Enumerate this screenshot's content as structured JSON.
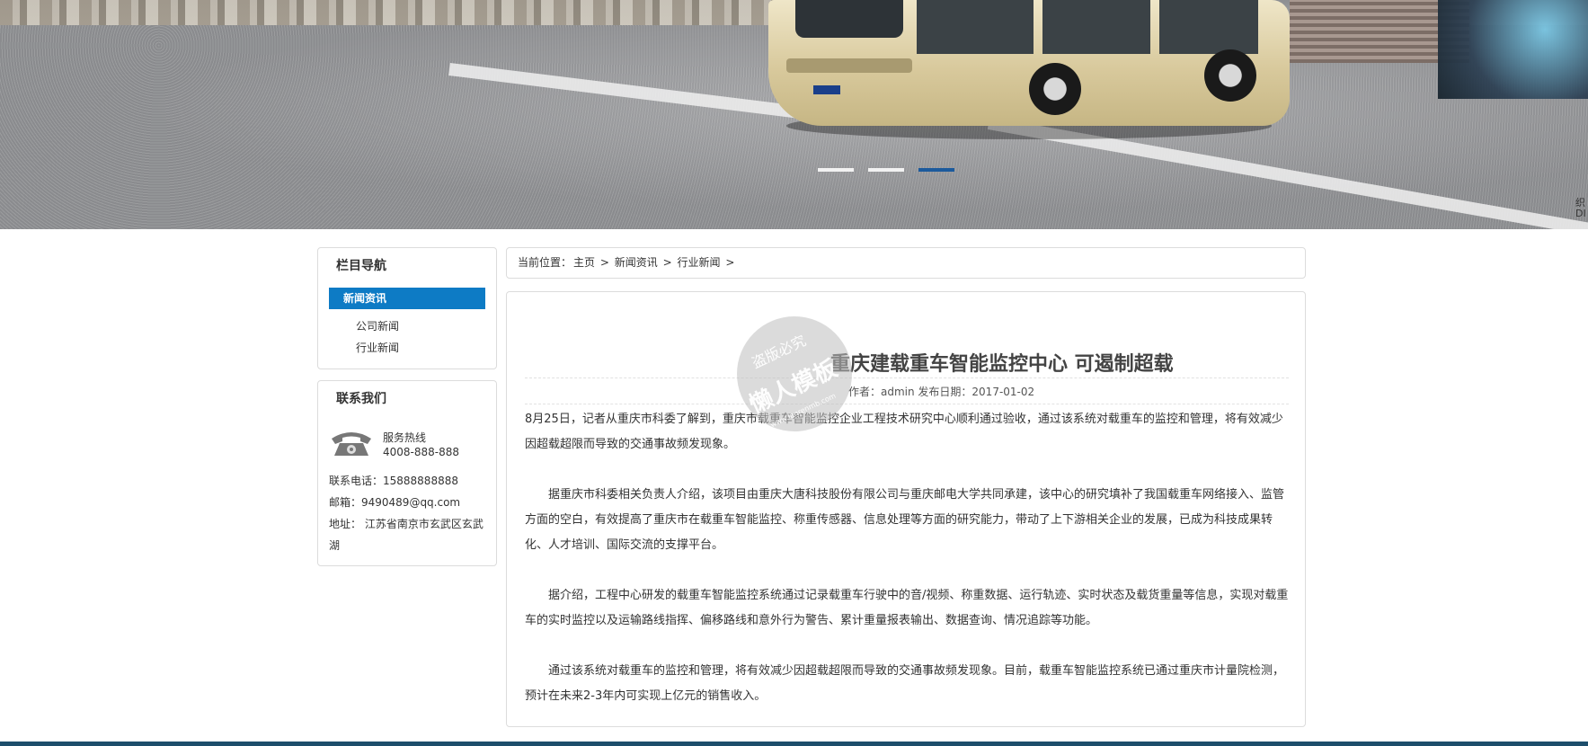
{
  "banner": {
    "slides": 3,
    "active_slide": 3,
    "edge_text": "织DI"
  },
  "sidebar": {
    "nav_title": "栏目导航",
    "active_item": "新闻资讯",
    "sub_items": [
      "公司新闻",
      "行业新闻"
    ],
    "contact_title": "联系我们",
    "hotline_label": "服务热线",
    "hotline_number": "4008-888-888",
    "phone": "联系电话：15888888888",
    "email": "邮箱：9490489@qq.com",
    "address": "地址： 江苏省南京市玄武区玄武湖"
  },
  "breadcrumb": {
    "prefix": "当前位置：",
    "items": [
      "主页",
      "新闻资讯",
      "行业新闻"
    ],
    "separator": ">"
  },
  "article": {
    "title": "重庆建载重车智能监控中心 可遏制超载",
    "meta": "作者：admin 发布日期：2017-01-02",
    "paragraphs": [
      "8月25日，记者从重庆市科委了解到，重庆市载重车智能监控企业工程技术研究中心顺利通过验收，通过该系统对载重车的监控和管理，将有效减少因超载超限而导致的交通事故频发现象。",
      "据重庆市科委相关负责人介绍，该项目由重庆大唐科技股份有限公司与重庆邮电大学共同承建，该中心的研究填补了我国载重车网络接入、监管方面的空白，有效提高了重庆市在载重车智能监控、称重传感器、信息处理等方面的研究能力，带动了上下游相关企业的发展，已成为科技成果转化、人才培训、国际交流的支撑平台。",
      "据介绍，工程中心研发的载重车智能监控系统通过记录载重车行驶中的音/视频、称重数据、运行轨迹、实时状态及载货重量等信息，实现对载重车的实时监控以及运输路线指挥、偏移路线和意外行为警告、累计重量报表输出、数据查询、情况追踪等功能。",
      "通过该系统对载重车的监控和管理，将有效减少因超载超限而导致的交通事故频发现象。目前，载重车智能监控系统已通过重庆市计量院检测，预计在未来2-3年内可实现上亿元的销售收入。"
    ]
  },
  "watermark": {
    "line1": "盗版必究",
    "line2": "懒人模板",
    "line3": "www.lanrenmb.com"
  },
  "colors": {
    "accent": "#0d7bc5",
    "slider_active": "#1c5a9c",
    "footer": "#1d4e6b"
  }
}
